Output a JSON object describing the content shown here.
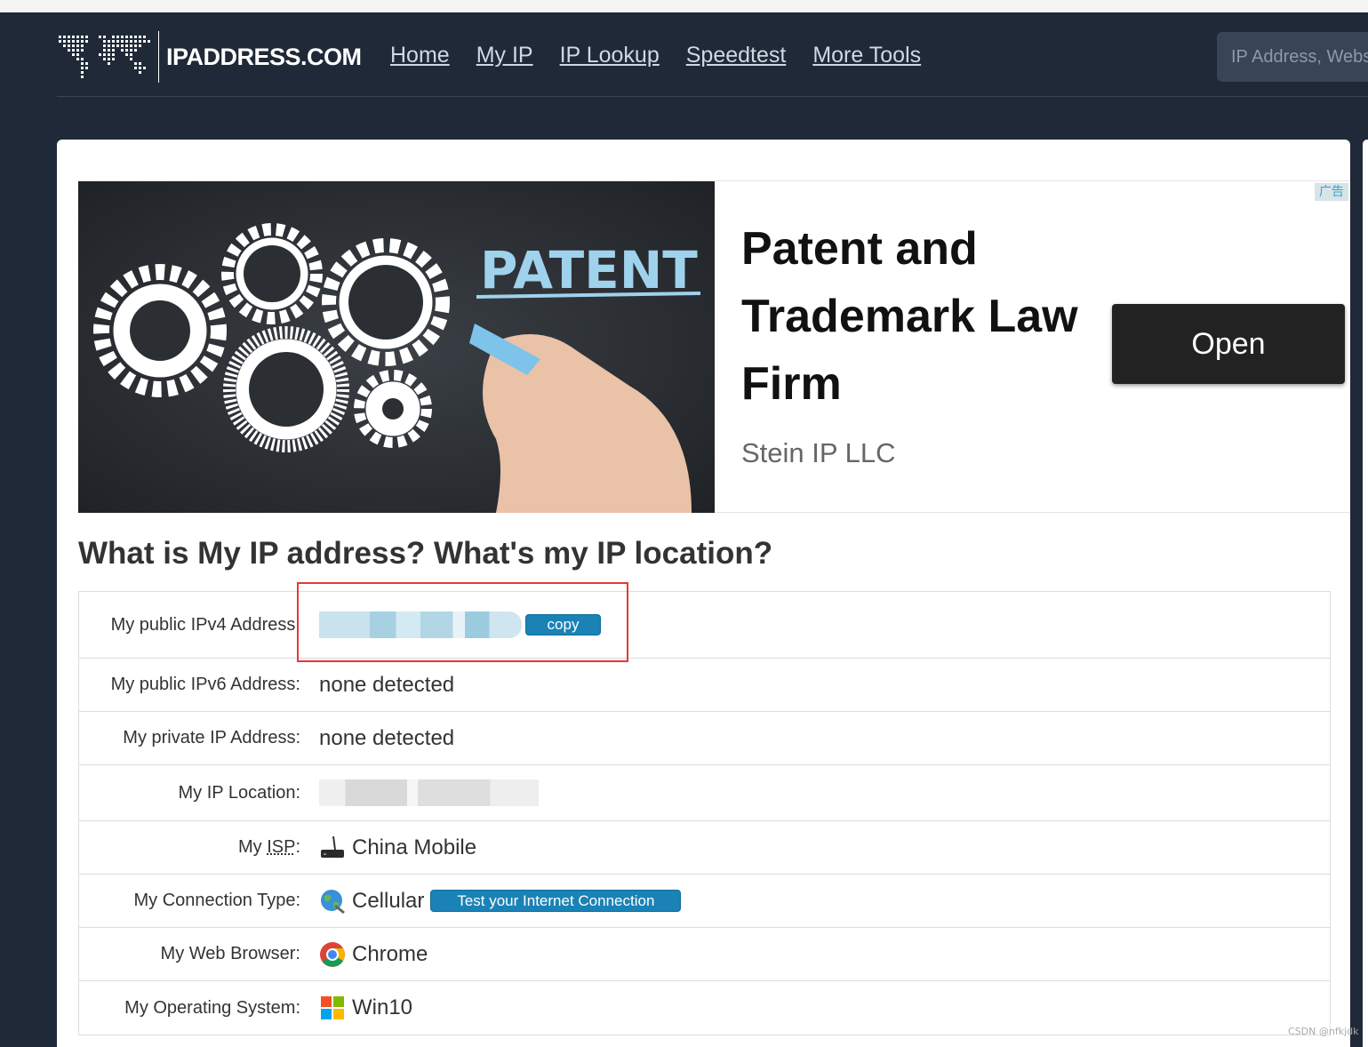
{
  "nav": {
    "logo_text": "IPADDRESS.COM",
    "links": [
      "Home",
      "My IP",
      "IP Lookup",
      "Speedtest",
      "More Tools"
    ],
    "search_placeholder": "IP Address, Website"
  },
  "ad": {
    "image_text": "PATENT",
    "title": "Patent and Trademark Law Firm",
    "advertiser": "Stein IP LLC",
    "button_label": "Open",
    "badge": "广告"
  },
  "main": {
    "heading": "What is My IP address? What's my IP location?",
    "rows": [
      {
        "label": "My public IPv4 Address:",
        "value": "",
        "button": "copy"
      },
      {
        "label": "My public IPv6 Address:",
        "value": "none detected"
      },
      {
        "label": "My private IP Address:",
        "value": "none detected"
      },
      {
        "label": "My IP Location:",
        "value": ""
      },
      {
        "label_prefix": "My ",
        "label_abbr": "ISP",
        "label_suffix": ":",
        "value": "China Mobile",
        "icon": "router-icon"
      },
      {
        "label": "My Connection Type:",
        "value": "Cellular",
        "icon": "globe-icon",
        "button": "Test your Internet Connection"
      },
      {
        "label": "My Web Browser:",
        "value": "Chrome",
        "icon": "chrome-icon"
      },
      {
        "label": "My Operating System:",
        "value": "Win10",
        "icon": "windows-icon"
      }
    ]
  },
  "watermark": "CSDN @nfkjdk",
  "colors": {
    "page_bg": "#1f2937",
    "accent_button": "#1a82b5",
    "highlight_box": "#e53935"
  }
}
